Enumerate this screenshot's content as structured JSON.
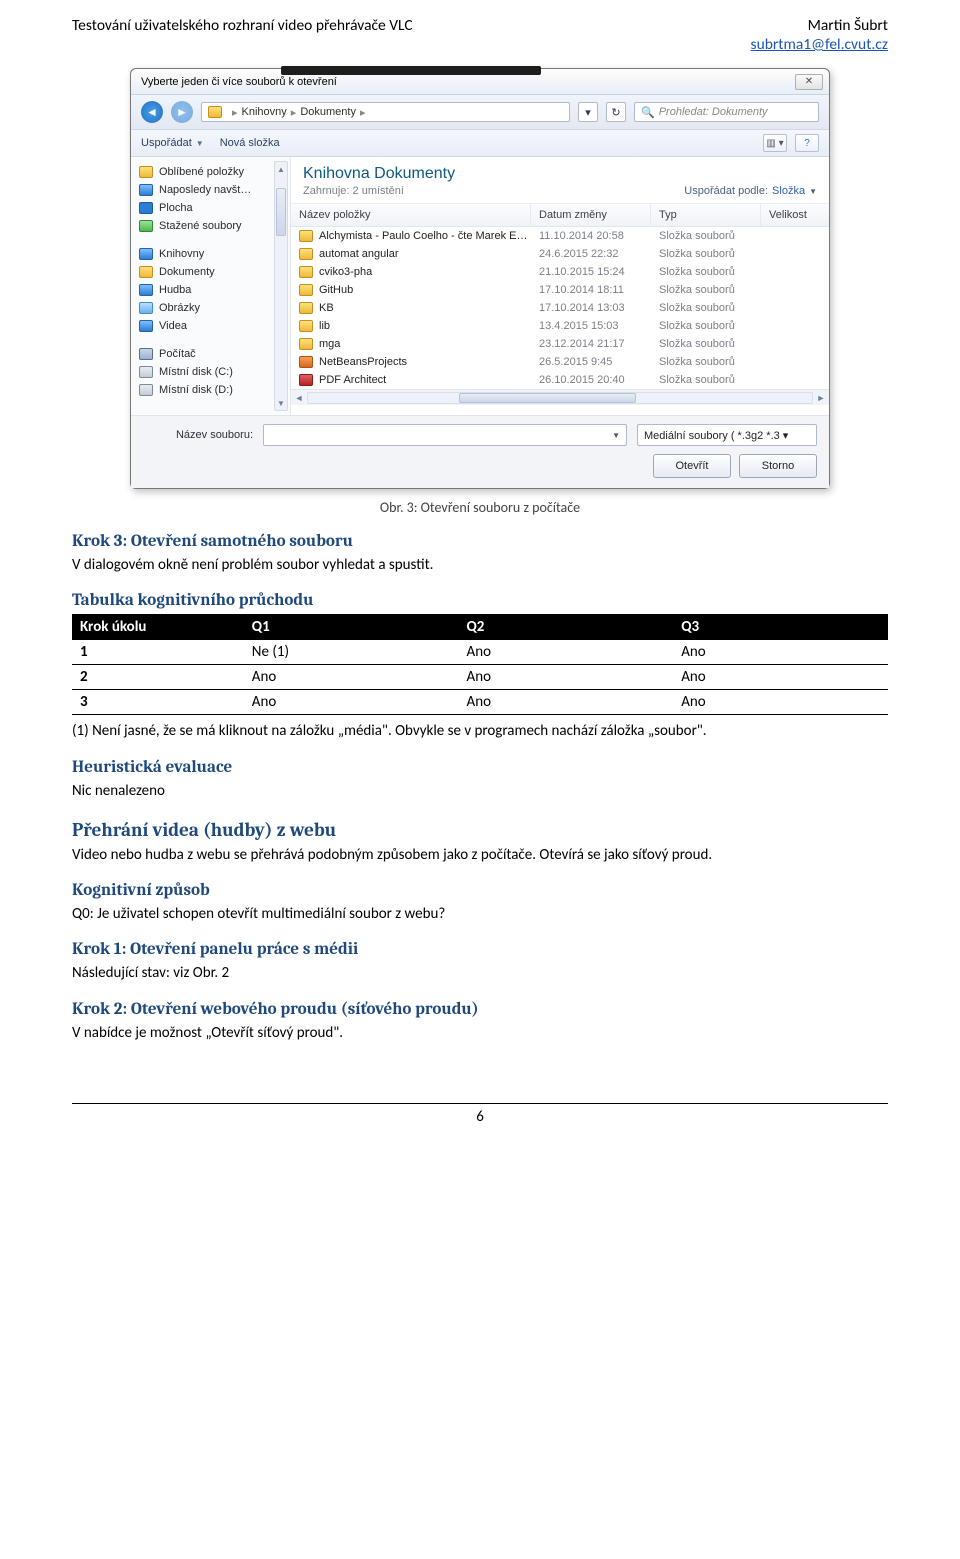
{
  "header": {
    "left": "Testování uživatelského rozhraní video přehrávače VLC",
    "right_name": "Martin Šubrt",
    "right_email": "subrtma1@fel.cvut.cz"
  },
  "dialog": {
    "title": "Vyberte jeden či více souborů k otevření",
    "close": "✕",
    "breadcrumb": {
      "root": "Knihovny",
      "child": "Dokumenty"
    },
    "refresh_aria": "↻",
    "search_placeholder": "Prohledat: Dokumenty",
    "toolbar": {
      "organize": "Uspořádat",
      "new_folder": "Nová složka"
    },
    "sidebar": {
      "fav_header": "Oblíbené položky",
      "fav": [
        "Naposledy navšt…",
        "Plocha",
        "Stažené soubory"
      ],
      "lib_header": "Knihovny",
      "lib": [
        "Dokumenty",
        "Hudba",
        "Obrázky",
        "Videa"
      ],
      "pc_header": "Počítač",
      "pc": [
        "Místní disk (C:)",
        "Místní disk (D:)"
      ]
    },
    "library": {
      "title": "Knihovna Dokumenty",
      "subtitle": "Zahrnuje: 2 umístění",
      "sort_label": "Uspořádat podle:",
      "sort_value": "Složka"
    },
    "columns": {
      "name": "Název položky",
      "date": "Datum změny",
      "type": "Typ",
      "size": "Velikost"
    },
    "rows": [
      {
        "icon": "folder",
        "name": "Alchymista - Paulo Coelho - čte Marek E…",
        "date": "11.10.2014 20:58",
        "type": "Složka souborů"
      },
      {
        "icon": "folder",
        "name": "automat angular",
        "date": "24.6.2015 22:32",
        "type": "Složka souborů"
      },
      {
        "icon": "folder",
        "name": "cviko3-pha",
        "date": "21.10.2015 15:24",
        "type": "Složka souborů"
      },
      {
        "icon": "folder",
        "name": "GitHub",
        "date": "17.10.2014 18:11",
        "type": "Složka souborů"
      },
      {
        "icon": "folder",
        "name": "KB",
        "date": "17.10.2014 13:03",
        "type": "Složka souborů"
      },
      {
        "icon": "folder",
        "name": "lib",
        "date": "13.4.2015 15:03",
        "type": "Složka souborů"
      },
      {
        "icon": "folder",
        "name": "mga",
        "date": "23.12.2014 21:17",
        "type": "Složka souborů"
      },
      {
        "icon": "app",
        "name": "NetBeansProjects",
        "date": "26.5.2015 9:45",
        "type": "Složka souborů"
      },
      {
        "icon": "pdf",
        "name": "PDF Architect",
        "date": "26.10.2015 20:40",
        "type": "Složka souborů"
      }
    ],
    "filename_label": "Název souboru:",
    "filter": "Mediální soubory ( *.3g2 *.3 ▾",
    "open": "Otevřít",
    "cancel": "Storno"
  },
  "caption": "Obr. 3: Otevření souboru z počítače",
  "doc": {
    "k3_title": "Krok 3: Otevření samotného souboru",
    "k3_body": "V dialogovém okně není problém soubor vyhledat a spustit.",
    "tab_title": "Tabulka kognitivního průchodu",
    "heu_title": "Heuristická evaluace",
    "heu_body": "Nic nenalezeno",
    "sec_title": "Přehrání videa (hudby) z webu",
    "sec_body": "Video nebo hudba z webu se přehrává podobným způsobem jako z počítače. Otevírá se jako síťový proud.",
    "kog_title": "Kognitivní způsob",
    "kog_body": "Q0: Je uživatel schopen otevřít multimediální soubor z webu?",
    "k1_title": "Krok 1: Otevření panelu práce s médii",
    "k1_body": "Následující stav: viz Obr. 2",
    "k2_title": "Krok 2: Otevření webového proudu (síťového proudu)",
    "k2_body": "V nabídce je možnost „Otevřít síťový proud\"."
  },
  "chart_data": {
    "type": "table",
    "title": "Tabulka kognitivního průchodu",
    "columns": [
      "Krok úkolu",
      "Q1",
      "Q2",
      "Q3"
    ],
    "rows": [
      [
        "1",
        "Ne (1)",
        "Ano",
        "Ano"
      ],
      [
        "2",
        "Ano",
        "Ano",
        "Ano"
      ],
      [
        "3",
        "Ano",
        "Ano",
        "Ano"
      ]
    ],
    "note": "(1) Není jasné, že se má kliknout na záložku „média\". Obvykle se v programech nachází záložka „soubor\"."
  },
  "page_number": "6"
}
